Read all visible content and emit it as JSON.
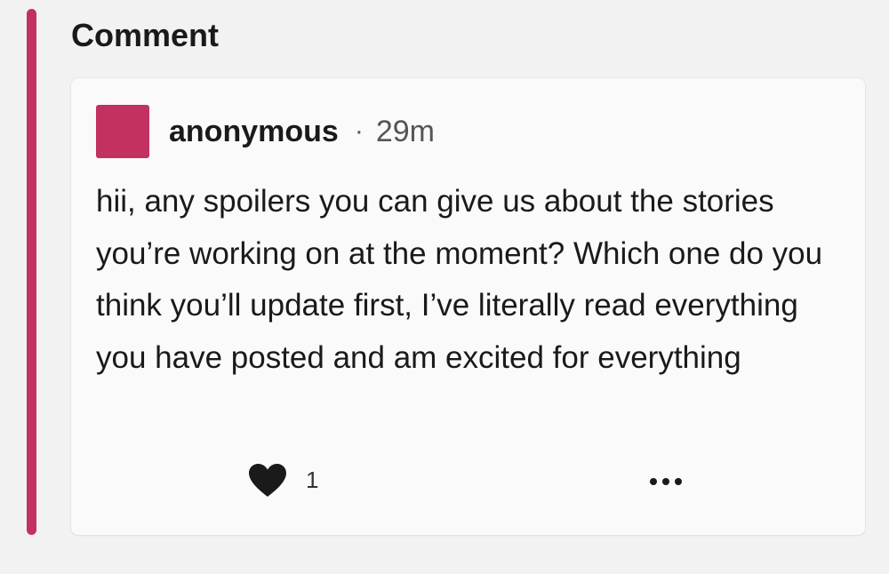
{
  "colors": {
    "accent": "#c2315f",
    "text": "#1a1a1a",
    "muted": "#555555",
    "card_bg": "#fafafa",
    "page_bg": "#f2f2f2"
  },
  "section": {
    "title": "Comment"
  },
  "comment": {
    "author": "anonymous",
    "separator": "·",
    "time": "29m",
    "text": "hii, any spoilers you can give us about the stories you’re working on at the moment? Which one do you think you’ll update first, I’ve literally read everything you have posted and am excited for everything",
    "likes": "1",
    "icons": {
      "like": "heart-icon",
      "more": "more-horizontal-icon"
    }
  }
}
